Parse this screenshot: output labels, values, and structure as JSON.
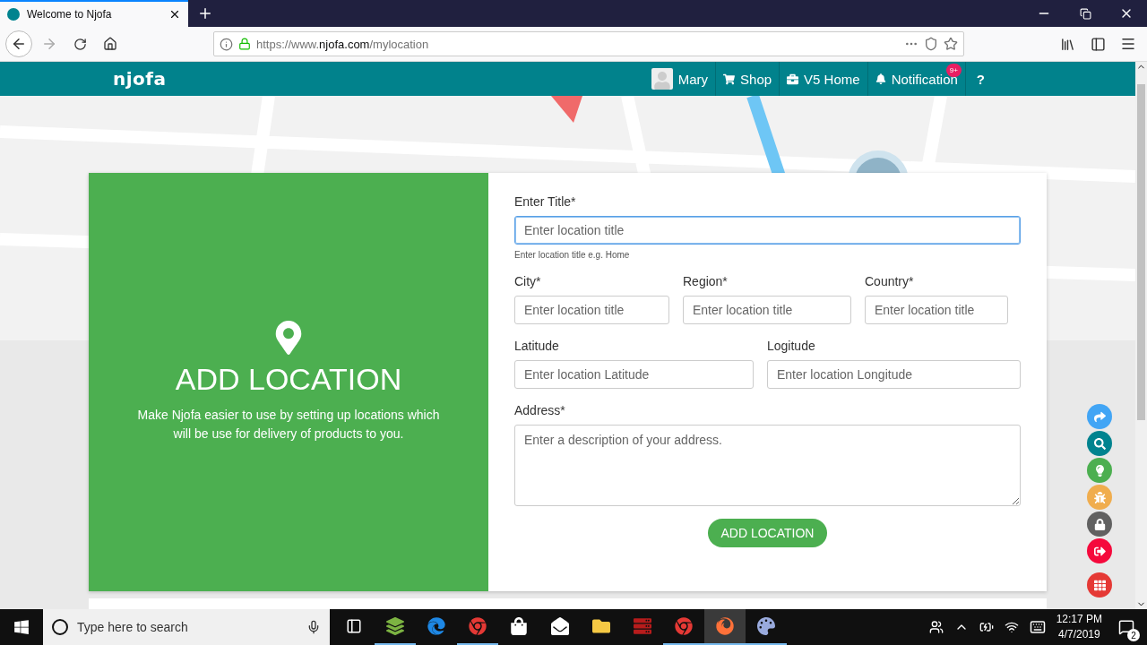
{
  "browser": {
    "tab_title": "Welcome to Njofa",
    "url_prefix": "https://www.",
    "url_domain": "njofa.com",
    "url_path": "/mylocation"
  },
  "header": {
    "logo": "njofa",
    "nav": [
      {
        "kind": "user",
        "label": "Mary"
      },
      {
        "kind": "shop",
        "label": "Shop"
      },
      {
        "kind": "home",
        "label": "V5 Home"
      },
      {
        "kind": "bell",
        "label": "Notification",
        "badge": "9+"
      },
      {
        "kind": "help",
        "label": "?"
      }
    ]
  },
  "panel": {
    "title": "ADD LOCATION",
    "description": "Make Njofa easier to use by setting up locations which will be use for delivery of products to you."
  },
  "form": {
    "rows": [
      [
        {
          "label": "Enter Title*",
          "placeholder": "Enter location title",
          "hint": "Enter location title e.g. Home",
          "focused": true
        }
      ],
      [
        {
          "label": "City*",
          "placeholder": "Enter location title",
          "focused": false
        },
        {
          "label": "Region*",
          "placeholder": "Enter location title",
          "focused": false
        },
        {
          "label": "Country*",
          "placeholder": "Enter location title",
          "focused": false
        }
      ],
      [
        {
          "label": "Latitude",
          "placeholder": "Enter location Latitude",
          "focused": false
        },
        {
          "label": "Logitude",
          "placeholder": "Enter location Longitude",
          "focused": false
        }
      ],
      [
        {
          "label": "Address*",
          "placeholder": "Enter a description of your address.",
          "kind": "textarea",
          "focused": false
        }
      ]
    ],
    "submit": "ADD LOCATION"
  },
  "floating_buttons": [
    {
      "kind": "share",
      "color": "#42a5f5"
    },
    {
      "kind": "search",
      "color": "#00838f"
    },
    {
      "kind": "bulb",
      "color": "#4caf50"
    },
    {
      "kind": "bug",
      "color": "#f0ad4e"
    },
    {
      "kind": "lock",
      "color": "#616161"
    },
    {
      "kind": "logout",
      "color": "#f5093c"
    },
    {
      "kind": "grid",
      "color": "#e53935"
    }
  ],
  "taskbar": {
    "search_placeholder": "Type here to search",
    "apps": [
      {
        "kind": "layers",
        "running": true,
        "selected": false
      },
      {
        "kind": "edge",
        "running": false,
        "selected": false
      },
      {
        "kind": "chrome",
        "running": true,
        "selected": false
      },
      {
        "kind": "store",
        "running": false,
        "selected": false
      },
      {
        "kind": "mail",
        "running": false,
        "selected": false
      },
      {
        "kind": "folder",
        "running": false,
        "selected": false
      },
      {
        "kind": "ftp",
        "running": false,
        "selected": false
      },
      {
        "kind": "chrome",
        "running": true,
        "selected": false
      },
      {
        "kind": "firefox",
        "running": true,
        "selected": true
      },
      {
        "kind": "paint",
        "running": true,
        "selected": false
      }
    ],
    "time": "12:17 PM",
    "date": "4/7/2019",
    "notifications": "2"
  }
}
